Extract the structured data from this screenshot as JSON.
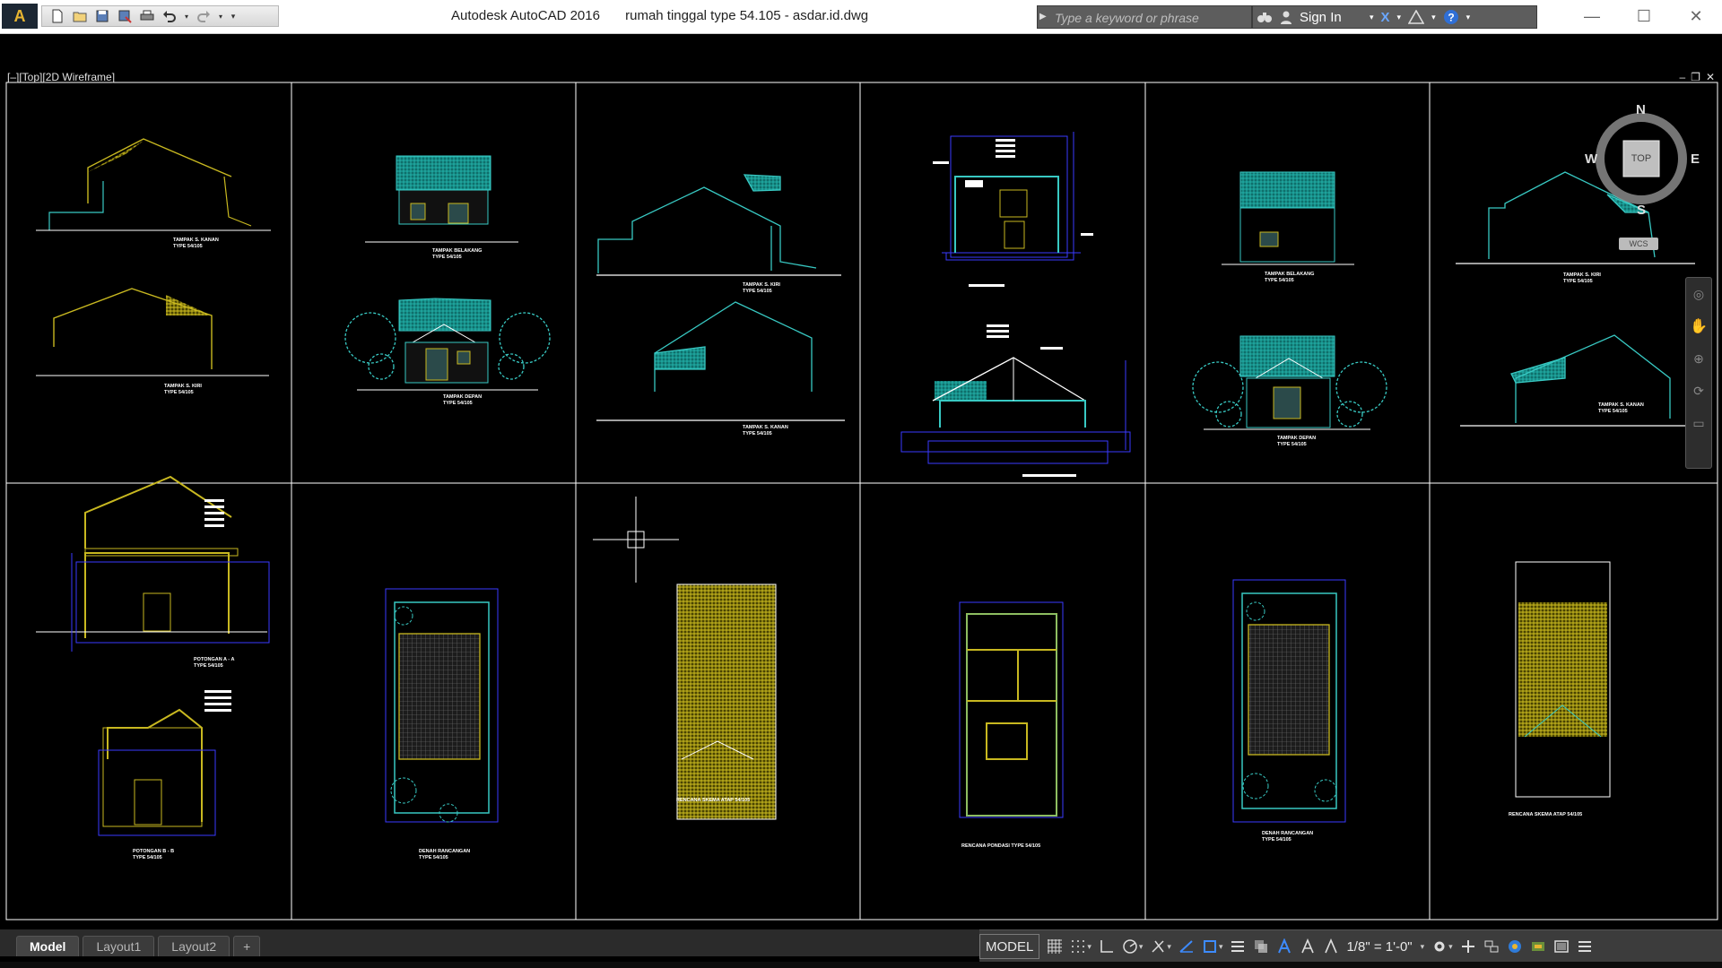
{
  "app": {
    "product": "Autodesk AutoCAD 2016",
    "file": "rumah tinggal type 54.105 - asdar.id.dwg",
    "logo_letter": "A"
  },
  "search": {
    "placeholder": "Type a keyword or phrase"
  },
  "toolbar": {
    "signin_label": "Sign In"
  },
  "viewport": {
    "label": "[–][Top][2D Wireframe]"
  },
  "viewcube": {
    "top": "TOP",
    "n": "N",
    "s": "S",
    "e": "E",
    "w": "W",
    "wcs": "WCS"
  },
  "sheets": {
    "r1c1": [
      "TAMPAK S. KANAN",
      "TYPE 54/105",
      "TAMPAK S. KIRI",
      "TYPE 54/105"
    ],
    "r1c2": [
      "TAMPAK BELAKANG",
      "TYPE 54/105",
      "TAMPAK DEPAN",
      "TYPE 54/105"
    ],
    "r1c3": [
      "TAMPAK S. KIRI",
      "TYPE 54/105",
      "TAMPAK S. KANAN",
      "TYPE 54/105"
    ],
    "r1c5": [
      "TAMPAK BELAKANG",
      "TYPE 54/105",
      "TAMPAK DEPAN",
      "TYPE 54/105"
    ],
    "r1c6": [
      "TAMPAK S. KIRI",
      "TYPE 54/105",
      "TAMPAK S. KANAN",
      "TYPE 54/105"
    ],
    "r2c1": [
      "POTONGAN A - A",
      "TYPE 54/105",
      "POTONGAN B - B",
      "TYPE 54/105"
    ],
    "r2c2": [
      "DENAH RANCANGAN",
      "TYPE 54/105"
    ],
    "r2c3": [
      "RENCANA SKEMA ATAP 54/105"
    ],
    "r2c4": [
      "RENCANA PONDASI TYPE 54/105"
    ],
    "r2c5": [
      "DENAH RANCANGAN",
      "TYPE 54/105"
    ],
    "r2c6": [
      "RENCANA SKEMA ATAP 54/105"
    ]
  },
  "layout_tabs": [
    "Model",
    "Layout1",
    "Layout2",
    "+"
  ],
  "status": {
    "model": "MODEL",
    "scale": "1/8\" = 1'-0\""
  },
  "colors": {
    "roof_teal": "#1aa5a0",
    "line_cyan": "#38c9c3",
    "wall_yellow": "#c8b820",
    "dim_blue": "#3a3aff",
    "grid_white": "#ffffff"
  }
}
